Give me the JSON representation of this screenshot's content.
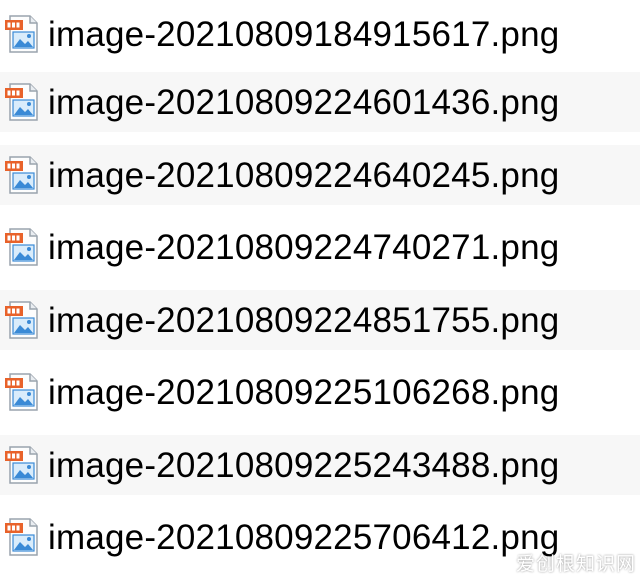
{
  "file_list": {
    "items": [
      {
        "name": "image-20210809184915617.png",
        "icon": "png-image-file-icon"
      },
      {
        "name": "image-20210809224601436.png",
        "icon": "png-image-file-icon"
      },
      {
        "name": "image-20210809224640245.png",
        "icon": "png-image-file-icon"
      },
      {
        "name": "image-20210809224740271.png",
        "icon": "png-image-file-icon"
      },
      {
        "name": "image-20210809224851755.png",
        "icon": "png-image-file-icon"
      },
      {
        "name": "image-20210809225106268.png",
        "icon": "png-image-file-icon"
      },
      {
        "name": "image-20210809225243488.png",
        "icon": "png-image-file-icon"
      },
      {
        "name": "image-20210809225706412.png",
        "icon": "png-image-file-icon"
      }
    ]
  },
  "watermark": {
    "text": "爱创根知识网"
  },
  "colors": {
    "background": "#ffffff",
    "row_alt_background": "#f7f7f7",
    "text": "#000000",
    "icon_badge": "#e8622a",
    "icon_picture": "#3a8ad6"
  }
}
